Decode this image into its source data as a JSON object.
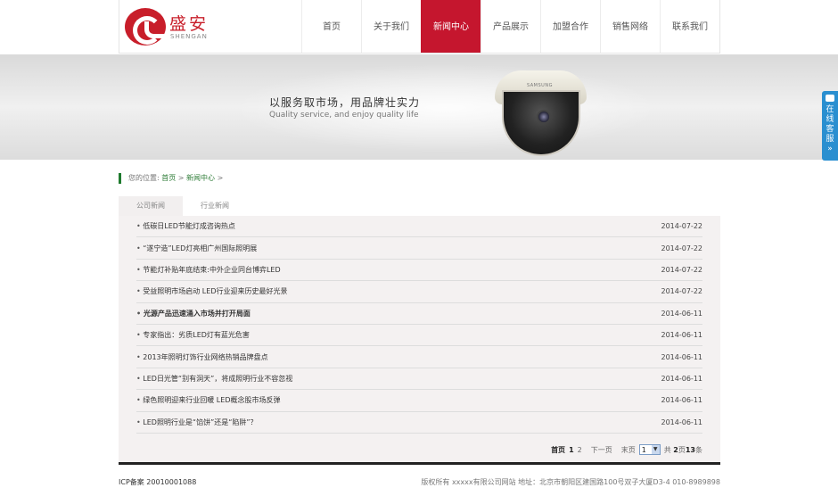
{
  "header": {
    "logo_cn": "盛安",
    "logo_en": "SHENGAN",
    "nav": [
      "首页",
      "关于我们",
      "新闻中心",
      "产品展示",
      "加盟合作",
      "销售网络",
      "联系我们"
    ],
    "active_index": 2
  },
  "banner": {
    "slogan": "以服务取市场，用品牌壮实力",
    "slogan_en": "Quality service, and enjoy quality life",
    "camera_brand": "SAMSUNG"
  },
  "chat_widget": {
    "label": "在线客服",
    "arrow": "»"
  },
  "breadcrumb": {
    "prefix": "您的位置:",
    "home": "首页",
    "sep": ">",
    "current": "新闻中心",
    "trail": ">"
  },
  "tabs": [
    "公司新闻",
    "行业新闻"
  ],
  "news": [
    {
      "title": "低碳日LED节能灯成咨询热点",
      "date": "2014-07-22",
      "bold": false
    },
    {
      "title": "“遂宁造”LED灯亮相广州国际照明展",
      "date": "2014-07-22",
      "bold": false
    },
    {
      "title": "节能灯补贴年底结束:中外企业同台博弈LED",
      "date": "2014-07-22",
      "bold": false
    },
    {
      "title": "受益照明市场启动 LED行业迎来历史最好光景",
      "date": "2014-07-22",
      "bold": false
    },
    {
      "title": "光源产品迅速涌入市场并打开局面",
      "date": "2014-06-11",
      "bold": true
    },
    {
      "title": "专家指出：劣质LED灯有蓝光危害",
      "date": "2014-06-11",
      "bold": false
    },
    {
      "title": "2013年照明灯饰行业网络热销品牌盘点",
      "date": "2014-06-11",
      "bold": false
    },
    {
      "title": "LED日光管“别有洞天”，将成照明行业不容忽视",
      "date": "2014-06-11",
      "bold": false
    },
    {
      "title": "绿色照明迎来行业回暖 LED概念股市场反弹",
      "date": "2014-06-11",
      "bold": false
    },
    {
      "title": "LED照明行业是“馅饼”还是“陷阱”？",
      "date": "2014-06-11",
      "bold": false
    }
  ],
  "pager": {
    "first": "首页",
    "current_page": "1",
    "page2": "2",
    "next": "下一页",
    "last": "末页",
    "select_value": "1",
    "total_prefix": "共",
    "total_pages": "2",
    "pages_unit": "页",
    "total_items": "13",
    "items_unit": "条"
  },
  "footer": {
    "icp": "ICP备案 20010001088",
    "copyright": "版权所有 xxxxx有限公司网站 地址：北京市朝阳区建国路100号双子大厦D3-4 010-8989898"
  },
  "colors": {
    "brand_red": "#c5162e",
    "breadcrumb_green": "#1f7a2e",
    "chat_blue": "#2a8fd0"
  }
}
